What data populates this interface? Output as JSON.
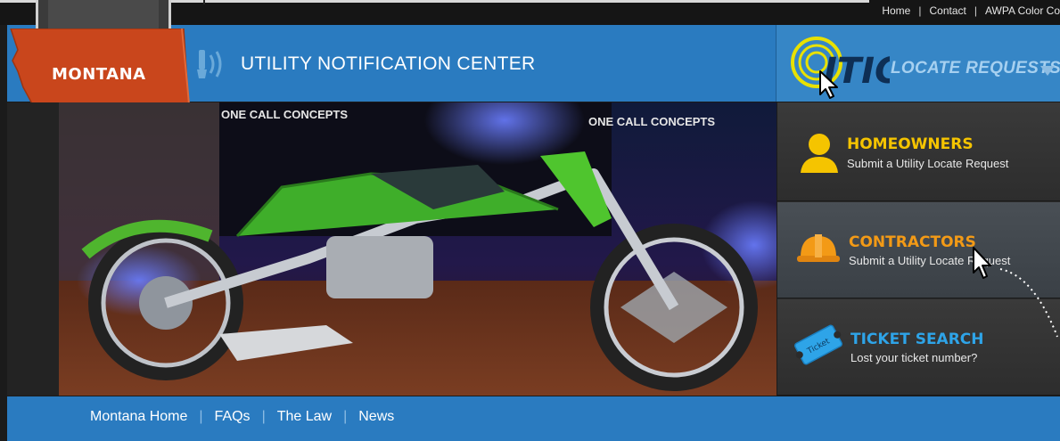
{
  "topbar": {
    "links": [
      "Home",
      "Contact",
      "AWPA Color Co"
    ],
    "separator": "|"
  },
  "header": {
    "title": "UTILITY NOTIFICATION CENTER",
    "state_badge": "MONTANA",
    "itic_logo_text": "ITIC",
    "locate_requests": "LOCATE REQUESTS"
  },
  "hero": {
    "image_desc_icon": "motorcycle-photo",
    "banner_text_1": "ONE CALL CONCEPTS",
    "banner_text_2": "ONE CALL CONCEPTS"
  },
  "panel": {
    "items": [
      {
        "title": "HOMEOWNERS",
        "subtitle": "Submit a Utility Locate Request",
        "icon": "person-icon",
        "color": "#f5c400"
      },
      {
        "title": "CONTRACTORS",
        "subtitle": "Submit a Utility Locate Request",
        "icon": "hardhat-icon",
        "color": "#f39a16"
      },
      {
        "title": "TICKET SEARCH",
        "subtitle": "Lost your ticket number?",
        "icon": "ticket-icon",
        "color": "#2ea4e8"
      }
    ]
  },
  "nav": {
    "links": [
      "Montana Home",
      "FAQs",
      "The Law",
      "News"
    ],
    "separator": "|"
  },
  "colors": {
    "header_blue": "#2a7bc0",
    "badge_red": "#c9461c",
    "accent_yellow": "#f5c400",
    "accent_orange": "#f39a16",
    "accent_blue": "#2ea4e8"
  }
}
